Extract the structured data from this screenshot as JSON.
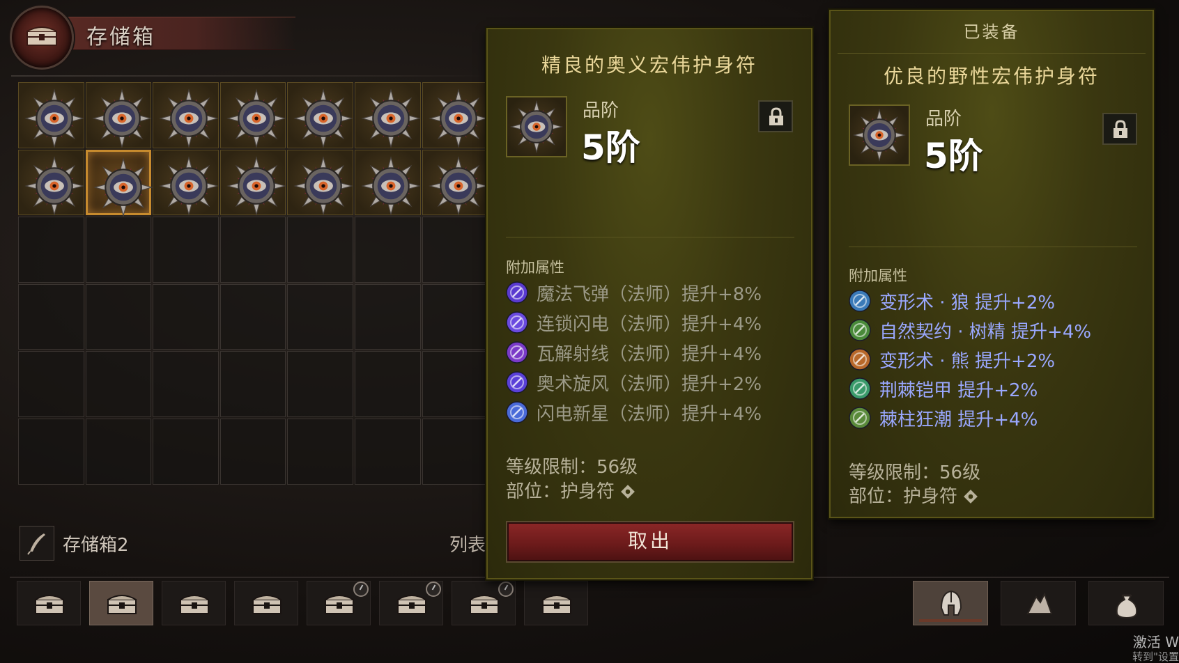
{
  "stash": {
    "title": "存储箱",
    "current_name": "存储箱2",
    "list_label": "列表",
    "rows_filled": 2,
    "cols_visible": 7,
    "selected_row": 1,
    "selected_col": 1
  },
  "compare_item": {
    "name": "精良的奥义宏伟护身符",
    "quality_label": "品阶",
    "quality_value": "5阶",
    "affix_header": "附加属性",
    "affixes": [
      {
        "text": "魔法飞弹（法师）提升+8%",
        "icon": "magic-missile-icon",
        "color": "#5a3ad0"
      },
      {
        "text": "连锁闪电（法师）提升+4%",
        "icon": "chain-lightning-icon",
        "color": "#6a4ae0"
      },
      {
        "text": "瓦解射线（法师）提升+4%",
        "icon": "disintegrate-icon",
        "color": "#7a3ac8"
      },
      {
        "text": "奥术旋风（法师）提升+2%",
        "icon": "arcane-vortex-icon",
        "color": "#5a40d8"
      },
      {
        "text": "闪电新星（法师）提升+4%",
        "icon": "lightning-nova-icon",
        "color": "#4a6ad8"
      }
    ],
    "level_req": "等级限制：56级",
    "slot": "部位：护身符",
    "take_out_label": "取出"
  },
  "equipped_item": {
    "label": "已装备",
    "name": "优良的野性宏伟护身符",
    "quality_label": "品阶",
    "quality_value": "5阶",
    "affix_header": "附加属性",
    "affixes": [
      {
        "text": "变形术 · 狼 提升+2%",
        "icon": "werewolf-icon",
        "color": "#3a7ab8"
      },
      {
        "text": "自然契约 · 树精 提升+4%",
        "icon": "treant-icon",
        "color": "#4a8a3a"
      },
      {
        "text": "变形术 · 熊 提升+2%",
        "icon": "werebear-icon",
        "color": "#b8682a"
      },
      {
        "text": "荆棘铠甲 提升+2%",
        "icon": "thorn-armor-icon",
        "color": "#3a9a6a"
      },
      {
        "text": "棘柱狂潮 提升+4%",
        "icon": "thorn-surge-icon",
        "color": "#5a8a3a"
      }
    ],
    "level_req": "等级限制：56级",
    "slot": "部位：护身符"
  },
  "stash_tabs": [
    {
      "id": 1,
      "locked_timer": false
    },
    {
      "id": 2,
      "locked_timer": false,
      "active": true
    },
    {
      "id": 3,
      "locked_timer": false
    },
    {
      "id": 4,
      "locked_timer": false
    },
    {
      "id": 5,
      "locked_timer": true
    },
    {
      "id": 6,
      "locked_timer": true
    },
    {
      "id": 7,
      "locked_timer": true
    },
    {
      "id": 8,
      "locked_timer": false
    }
  ],
  "right_tabs": [
    {
      "icon": "helmet-icon",
      "active": true
    },
    {
      "icon": "materials-icon",
      "active": false
    },
    {
      "icon": "pouch-icon",
      "active": false
    }
  ],
  "watermark": {
    "line1": "激活 W",
    "line2": "转到\"设置"
  }
}
